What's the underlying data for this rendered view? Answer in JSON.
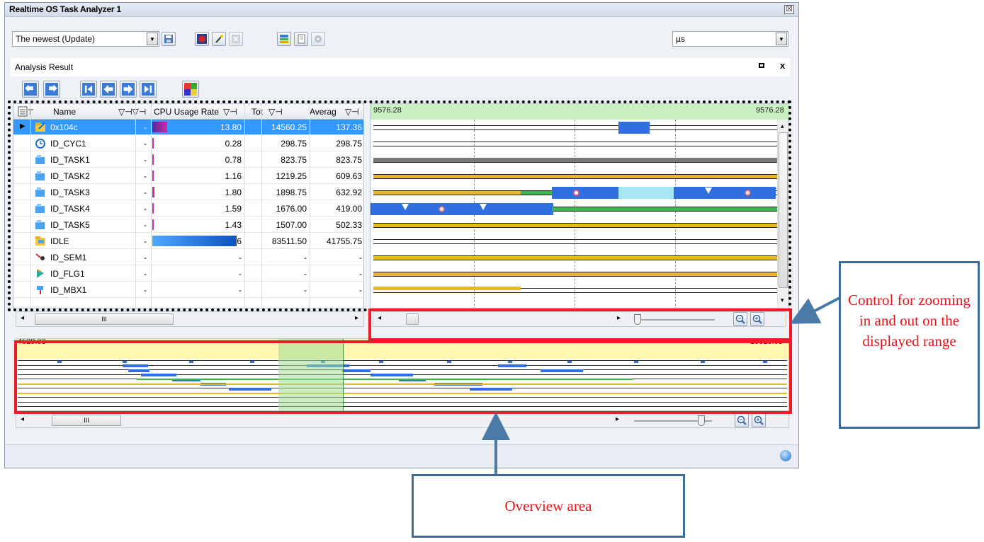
{
  "window": {
    "title": "Realtime OS Task Analyzer 1",
    "close_glyph": "☒"
  },
  "toolbar": {
    "mode_select": "The newest (Update)",
    "unit_select": "µs",
    "icons": [
      "save-icon",
      "record-icon",
      "magic-wand-icon",
      "stop-icon",
      "layout-icon",
      "document-icon",
      "settings-icon"
    ]
  },
  "pane": {
    "title": "Analysis Result",
    "close": "x"
  },
  "nav_icons": [
    "back-icon",
    "forward-icon",
    "first-icon",
    "previous-icon",
    "next-icon",
    "last-icon",
    "palette-icon"
  ],
  "grid": {
    "headers": {
      "name": "Name",
      "cpu": "CPU Usage Rate",
      "tot": "Tot",
      "avg": "Averag"
    },
    "rows": [
      {
        "name": "0x104c",
        "dash": "-",
        "cpu": "13.80",
        "tot": "14560.25",
        "avg": "137.36",
        "icon": "task-folder-icon",
        "usage": 0.138,
        "selected": true
      },
      {
        "name": "ID_CYC1",
        "dash": "-",
        "cpu": "0.28",
        "tot": "298.75",
        "avg": "298.75",
        "icon": "cyclic-handler-icon",
        "usage": 0.0028
      },
      {
        "name": "ID_TASK1",
        "dash": "-",
        "cpu": "0.78",
        "tot": "823.75",
        "avg": "823.75",
        "icon": "task-icon",
        "usage": 0.0078
      },
      {
        "name": "ID_TASK2",
        "dash": "-",
        "cpu": "1.16",
        "tot": "1219.25",
        "avg": "609.63",
        "icon": "task-icon",
        "usage": 0.0116
      },
      {
        "name": "ID_TASK3",
        "dash": "-",
        "cpu": "1.80",
        "tot": "1898.75",
        "avg": "632.92",
        "icon": "task-icon",
        "usage": 0.018
      },
      {
        "name": "ID_TASK4",
        "dash": "-",
        "cpu": "1.59",
        "tot": "1676.00",
        "avg": "419.00",
        "icon": "task-icon",
        "usage": 0.0159
      },
      {
        "name": "ID_TASK5",
        "dash": "-",
        "cpu": "1.43",
        "tot": "1507.00",
        "avg": "502.33",
        "icon": "task-icon",
        "usage": 0.0143
      },
      {
        "name": "IDLE",
        "dash": "-",
        "cpu": "79.16",
        "tot": "83511.50",
        "avg": "41755.75",
        "icon": "idle-folder-icon",
        "usage": 0.7916
      },
      {
        "name": "ID_SEM1",
        "dash": "-",
        "cpu": "-",
        "tot": "-",
        "avg": "-",
        "icon": "semaphore-icon",
        "usage": 0
      },
      {
        "name": "ID_FLG1",
        "dash": "-",
        "cpu": "-",
        "tot": "-",
        "avg": "-",
        "icon": "eventflag-icon",
        "usage": 0
      },
      {
        "name": "ID_MBX1",
        "dash": "-",
        "cpu": "-",
        "tot": "-",
        "avg": "-",
        "icon": "mailbox-icon",
        "usage": 0
      }
    ],
    "scroll_glyph": "III"
  },
  "timeline": {
    "start": "9576.28",
    "end": "9576.28"
  },
  "overview": {
    "start": "4529.03",
    "end": "19529.03",
    "scroll_glyph": "III"
  },
  "annotations": {
    "zoom": "Control for zooming in and out on the displayed range",
    "overview": "Overview area"
  },
  "colors": {
    "accent_red": "#ee1c24",
    "callout_border": "#3d6a99",
    "run_blue": "#2f6fe0",
    "ready_yellow": "#e8b824",
    "wait_green": "#3cb84a"
  }
}
